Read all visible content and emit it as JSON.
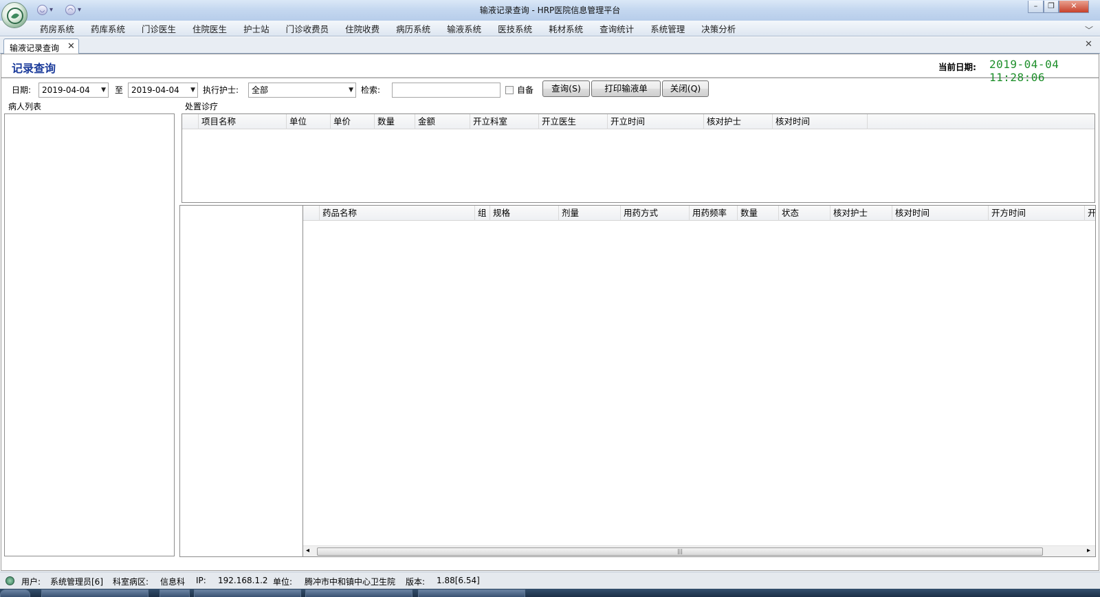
{
  "window": {
    "title": "输液记录查询 - HRP医院信息管理平台",
    "minimize_glyph": "–",
    "restore_glyph": "❐",
    "close_glyph": "✕",
    "quick_access_dropdown": "▾"
  },
  "menu": {
    "items": [
      "药房系统",
      "药库系统",
      "门诊医生",
      "住院医生",
      "护士站",
      "门诊收费员",
      "住院收费",
      "病历系统",
      "输液系统",
      "医技系统",
      "耗材系统",
      "查询统计",
      "系统管理",
      "决策分析"
    ],
    "expand_glyph": "﹀"
  },
  "tabs": {
    "active_label": "输液记录查询",
    "close_glyph": "✕",
    "bar_close_glyph": "✕"
  },
  "header": {
    "title": "记录查询",
    "current_date_label": "当前日期:",
    "current_date_value": "2019-04-04 11:28:06"
  },
  "filters": {
    "date_label": "日期:",
    "date_from": "2019-04-04",
    "to_label": "至",
    "date_to": "2019-04-04",
    "nurse_label": "执行护士:",
    "nurse_value": "全部",
    "search_label": "检索:",
    "search_value": "",
    "self_supply_label": "自备",
    "self_supply_checked": false,
    "query_button": "查询(S)",
    "print_button": "打印输液单",
    "close_button": "关闭(Q)",
    "dropdown_arrow": "▼"
  },
  "patient_list": {
    "title": "病人列表"
  },
  "treatment": {
    "title": "处置诊疗",
    "columns": [
      "项目名称",
      "单位",
      "单价",
      "数量",
      "金额",
      "开立科室",
      "开立医生",
      "开立时间",
      "核对护士",
      "核对时间"
    ]
  },
  "drugs": {
    "columns": [
      "药品名称",
      "组",
      "规格",
      "剂量",
      "用药方式",
      "用药频率",
      "数量",
      "状态",
      "核对护士",
      "核对时间",
      "开方时间",
      "开"
    ]
  },
  "scrollbar": {
    "left_arrow": "◂",
    "right_arrow": "▸",
    "grip": "|||"
  },
  "status": {
    "user_label": "用户:",
    "user_value": "系统管理员[6]",
    "dept_label": "科室病区:",
    "dept_value": "信息科",
    "ip_label": "IP:",
    "ip_value": "192.168.1.2",
    "unit_label": "单位:",
    "unit_value": "腾冲市中和镇中心卫生院",
    "version_label": "版本:",
    "version_value": "1.88[6.54]"
  },
  "colors": {
    "title_bar": "#c5d8f0",
    "heading_blue": "#1a3a9a",
    "date_green": "#1d8f2a",
    "close_red": "#c7412b"
  },
  "icons": [
    "app-logo-icon",
    "quick-access-icon",
    "minimize-icon",
    "restore-icon",
    "close-icon",
    "chevron-down-icon",
    "status-app-icon"
  ]
}
